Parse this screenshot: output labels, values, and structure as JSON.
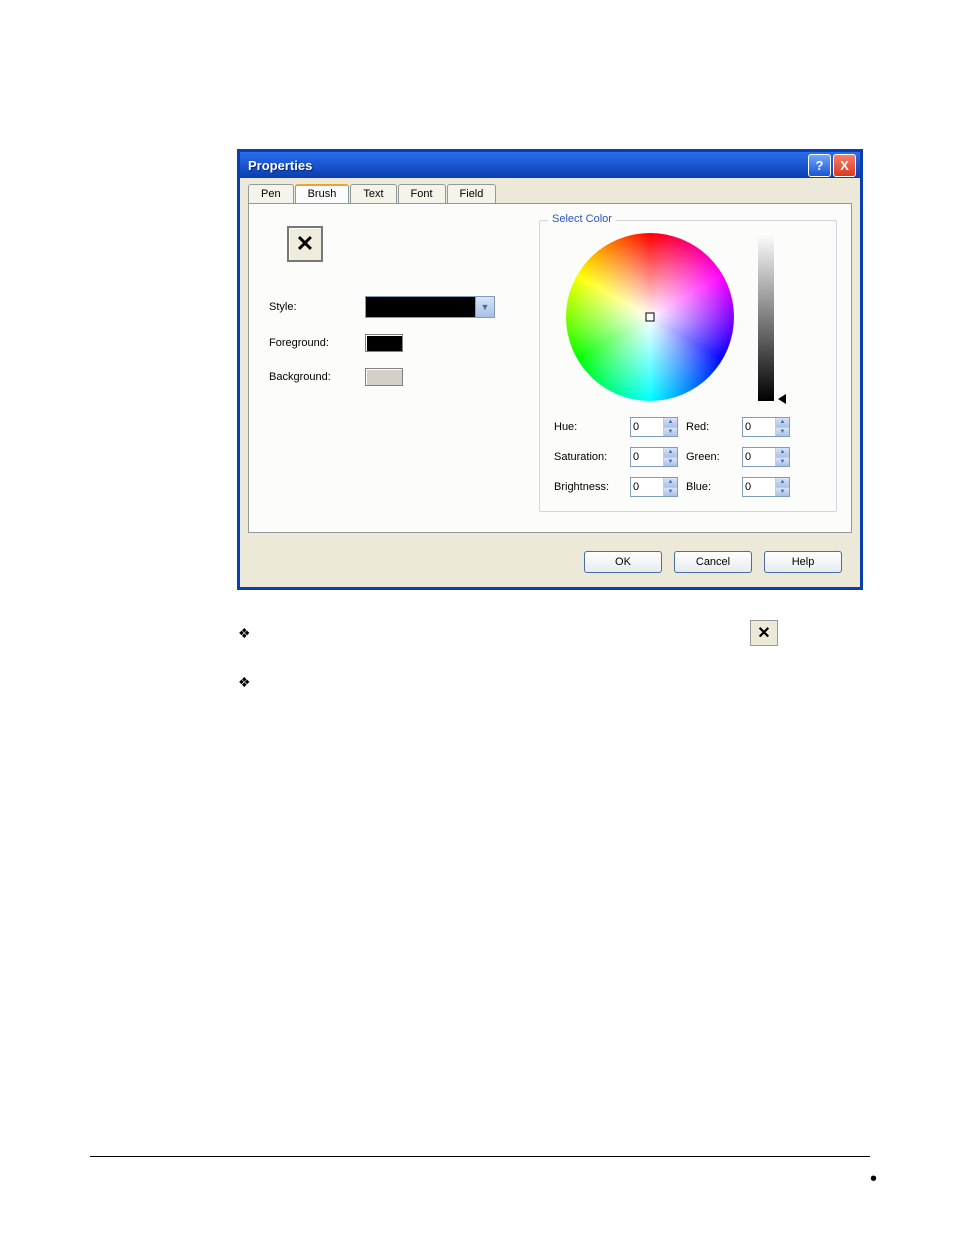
{
  "dialog": {
    "title": "Properties",
    "tabs": [
      "Pen",
      "Brush",
      "Text",
      "Font",
      "Field"
    ],
    "active_tab": "Brush",
    "left": {
      "style_label": "Style:",
      "foreground_label": "Foreground:",
      "background_label": "Background:",
      "foreground_color": "#000000",
      "background_color": "#d4d0c8"
    },
    "colorpicker": {
      "legend": "Select Color",
      "labels": {
        "hue": "Hue:",
        "saturation": "Saturation:",
        "brightness": "Brightness:",
        "red": "Red:",
        "green": "Green:",
        "blue": "Blue:"
      },
      "values": {
        "hue": 0,
        "saturation": 0,
        "brightness": 0,
        "red": 0,
        "green": 0,
        "blue": 0
      }
    },
    "buttons": {
      "ok": "OK",
      "cancel": "Cancel",
      "help": "Help"
    }
  },
  "titlebar_buttons": {
    "help": "?",
    "close": "X"
  },
  "footnote_bullet": "❖"
}
